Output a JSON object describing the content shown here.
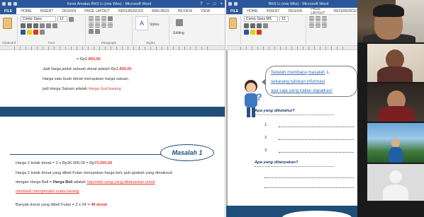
{
  "left_window": {
    "title": "Kemi Amalan BKS Li (mis Wks) - Microsoft Word",
    "tabs": [
      "FILE",
      "HOME",
      "INSERT",
      "DESIGN",
      "PAGE LAYOUT",
      "REFERENCES",
      "MAILINGS",
      "REVIEW",
      "VIEW"
    ],
    "ribbon": {
      "font_name": "Comic Sans",
      "font_size": "12",
      "styles_label": "Styles",
      "editing_label": "Editing",
      "group_clipboard": "Clipboard",
      "group_font": "Font",
      "group_paragraph": "Paragraph",
      "group_styles": "Styles"
    },
    "document": {
      "line1_prefix": "= Rp1.",
      "line1_value": "800,00",
      "line2_text": "Jadi harga jeduk sebuah donat adalah Rp1.",
      "line2_value": "800,00",
      "line3_text": "Harga satu buah donat merupakan harga satuan,",
      "line4_text": "jadi Harga Satuan adalah",
      "line4_link": "Harga Jual barang",
      "masalah_label": "Masalah 1",
      "p1_prefix": "Harga 2 kotak donat = 2 x Rp36.000,00 = Rp",
      "p1_value": "72.000,00",
      "p2a": "Harga 2 kotak donat yang dibeli Fulan merupakan harga beli, jadi apakah yang dimaksud",
      "p2b_prefix": "dengan Harga Beli",
      "p2b_mid": "Harga Beli",
      "p2b_link": "Sejumlah uang yang dikeluarkan untuk",
      "p2c_link": "membeli/ memperoleh suatu barang",
      "p3_prefix": "Banyak donat yang dibeli Fulan = 2 x 24 =",
      "p3_value": "48 donat"
    }
  },
  "right_window": {
    "title": "BKS Li (mis Wks) - Microsoft Word",
    "tabs": [
      "FILE",
      "HOME",
      "INSERT",
      "DESIGN",
      "PAGE LAYOUT",
      "REFERENCES"
    ],
    "ribbon": {
      "font_name": "Comic Sans MS",
      "font_size": "12"
    },
    "document": {
      "speech_line1": "Setelah membaca",
      "speech_line1_ul": "masalah",
      "speech_line1_end": "1,",
      "speech_line2": "sekarang tuliskan informasi",
      "speech_line3": "apa saja yang kalian dapatkan!",
      "q1": "Apa yang diketahui?",
      "items": [
        "1.",
        "2.",
        "3."
      ],
      "q2": "Apa yang ditanyakan?"
    }
  },
  "video_participants": [
    {
      "kind": "camera",
      "label": "main-speaker"
    },
    {
      "kind": "camera",
      "label": "participant-2"
    },
    {
      "kind": "camera",
      "label": "participant-3"
    },
    {
      "kind": "camera",
      "label": "participant-4"
    },
    {
      "kind": "placeholder",
      "label": "participant-5"
    }
  ],
  "colors": {
    "word_blue": "#2b579a",
    "band_navy": "#1f4e79",
    "highlight_red": "#e8352b"
  }
}
